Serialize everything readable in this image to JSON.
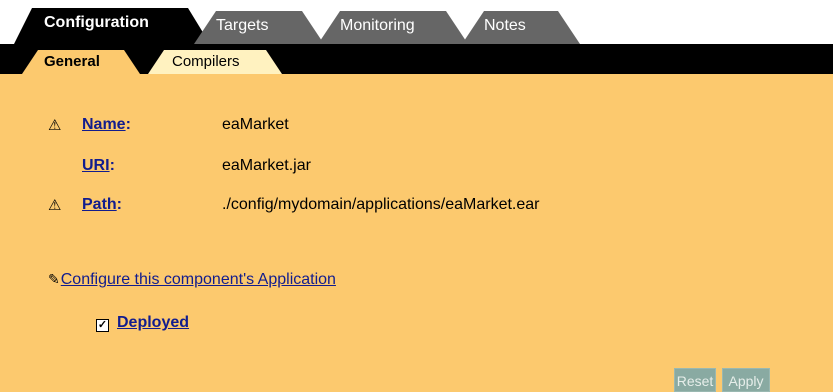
{
  "tabs": [
    {
      "label": "Configuration"
    },
    {
      "label": "Targets"
    },
    {
      "label": "Monitoring"
    },
    {
      "label": "Notes"
    }
  ],
  "subtabs": [
    {
      "label": "General"
    },
    {
      "label": "Compilers"
    }
  ],
  "fields": {
    "name": {
      "label": "Name",
      "colon": ":",
      "value": "eaMarket"
    },
    "uri": {
      "label": "URI",
      "colon": ":",
      "value": "eaMarket.jar"
    },
    "path": {
      "label": "Path",
      "colon": ":",
      "value": "./config/mydomain/applications/eaMarket.ear"
    }
  },
  "warning_glyph": "⚠",
  "configure_link": "Configure this component's Application",
  "pencil_glyph": "✎",
  "deployed": {
    "label": "Deployed",
    "checked": true,
    "check_glyph": "✓"
  },
  "buttons": {
    "reset": "Reset",
    "apply": "Apply"
  },
  "colors": {
    "panel": "#fcc96e",
    "link": "#111c8e",
    "tab_inactive": "#666666",
    "subtab_inactive": "#fff2c0",
    "button": "#89aaa2"
  }
}
